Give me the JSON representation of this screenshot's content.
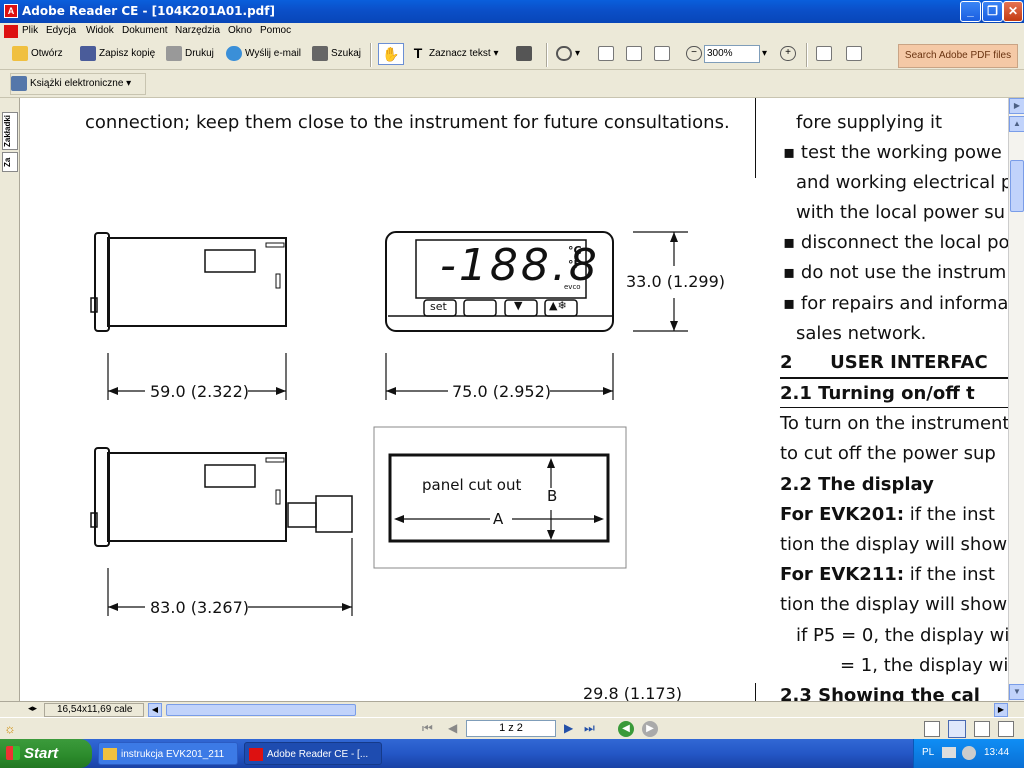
{
  "window": {
    "title": "Adobe Reader CE - [104K201A01.pdf]",
    "app_icon": "acrobat-icon"
  },
  "menu": [
    "Plik",
    "Edycja",
    "Widok",
    "Dokument",
    "Narzędzia",
    "Okno",
    "Pomoc"
  ],
  "toolbar": {
    "open": "Otwórz",
    "save_copy": "Zapisz kopię",
    "print": "Drukuj",
    "email": "Wyślij e-mail",
    "search": "Szukaj",
    "select_text": "Zaznacz tekst",
    "zoom": "300%",
    "search_adobe": "Search Adobe PDF files",
    "ebooks": "Książki elektroniczne"
  },
  "side_tabs": [
    "Zakładki",
    "Za"
  ],
  "doc": {
    "top_text": "connection; keep them close to the instrument for future consultations.",
    "dim1": "59.0 (2.322)",
    "dim2": "75.0 (2.952)",
    "dim3": "33.0 (1.299)",
    "dim4": "83.0 (3.267)",
    "dim5": "29.8 (1.173)",
    "panel_label": "panel cut out",
    "label_a": "A",
    "label_b": "B",
    "display_digits": "-188.8",
    "unit_c": "°C",
    "unit_f": "°F",
    "brand": "evco",
    "btn_set": "set",
    "right": {
      "l1": "fore supplying it",
      "b1": "test the working powe",
      "l2": "and working electrical p",
      "l3": "with the local power su",
      "b2": "disconnect the local po",
      "b3": "do not use the instrum",
      "b4": "for repairs and informa",
      "l4": "sales network.",
      "h1": "2      USER INTERFAC",
      "h2": "2.1  Turning on/off t",
      "p1": "To turn on the instrument",
      "p2": "to cut off the power sup",
      "h3": "2.2  The display",
      "e1b": "For EVK201:",
      "e1": " if the inst",
      "p3": "tion the display will show",
      "e2b": "For EVK211:",
      "e2": " if the inst",
      "p4": "tion the display will show",
      "p5": "if P5 = 0, the display wi",
      "p6": "= 1, the display wi",
      "h4": "2.3  Showing the cal"
    }
  },
  "status": {
    "page_size": "16,54x11,69 cale"
  },
  "nav": {
    "page": "1 z 2"
  },
  "taskbar": {
    "start": "Start",
    "tasks": [
      "instrukcja EVK201_211",
      "Adobe Reader CE - [..."
    ],
    "lang": "PL",
    "clock": "13:44"
  }
}
